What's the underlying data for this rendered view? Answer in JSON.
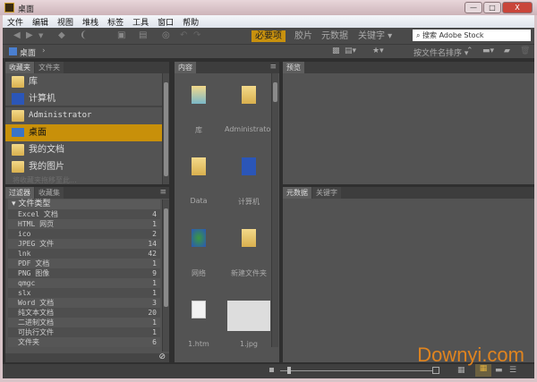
{
  "window": {
    "title": "桌面",
    "min": "—",
    "max": "□",
    "close": "X"
  },
  "menu": [
    "文件",
    "编辑",
    "视图",
    "堆栈",
    "标签",
    "工具",
    "窗口",
    "帮助"
  ],
  "toolbar": {
    "workspaces": [
      {
        "label": "必要项",
        "active": true
      },
      {
        "label": "胶片"
      },
      {
        "label": "元数据"
      },
      {
        "label": "关键字 ▾"
      }
    ],
    "search_placeholder": "搜索 Adobe Stock"
  },
  "pathbar": {
    "path": "桌面",
    "chevron": "›",
    "sort": "按文件名排序 ▾"
  },
  "favorites_panel": {
    "tabs": [
      "收藏夹",
      "文件夹"
    ],
    "items": [
      {
        "label": "库"
      },
      {
        "label": "计算机"
      },
      {
        "label": "Administrator"
      },
      {
        "label": "桌面",
        "selected": true
      },
      {
        "label": "我的文档"
      },
      {
        "label": "我的图片"
      }
    ],
    "hint": "将收藏夹拖移至此..."
  },
  "filter_panel": {
    "tabs": [
      "过滤器",
      "收藏集"
    ],
    "group": "文件类型",
    "rows": [
      {
        "label": "Excel 文档",
        "count": "4"
      },
      {
        "label": "HTML 网页",
        "count": "1"
      },
      {
        "label": "ico",
        "count": "2"
      },
      {
        "label": "JPEG 文件",
        "count": "14"
      },
      {
        "label": "lnk",
        "count": "42"
      },
      {
        "label": "PDF 文档",
        "count": "1"
      },
      {
        "label": "PNG 图像",
        "count": "9"
      },
      {
        "label": "qmgc",
        "count": "1"
      },
      {
        "label": "slx",
        "count": "1"
      },
      {
        "label": "Word 文档",
        "count": "3"
      },
      {
        "label": "纯文本文档",
        "count": "20"
      },
      {
        "label": "二进制文档",
        "count": "1"
      },
      {
        "label": "可执行文件",
        "count": "1"
      },
      {
        "label": "文件夹",
        "count": "6"
      }
    ]
  },
  "content_panel": {
    "tab": "内容",
    "items": [
      {
        "label": "库"
      },
      {
        "label": "Administrator"
      },
      {
        "label": "Data"
      },
      {
        "label": "计算机"
      },
      {
        "label": "网络"
      },
      {
        "label": "新建文件夹"
      },
      {
        "label": "1.htm"
      },
      {
        "label": "1.jpg"
      }
    ]
  },
  "preview_panel": {
    "tab": "预览"
  },
  "metadata_panel": {
    "tabs": [
      "元数据",
      "关键字"
    ]
  },
  "watermark": "Downyi.com",
  "colors": {
    "accent": "#c8900a",
    "panel": "#535353"
  }
}
